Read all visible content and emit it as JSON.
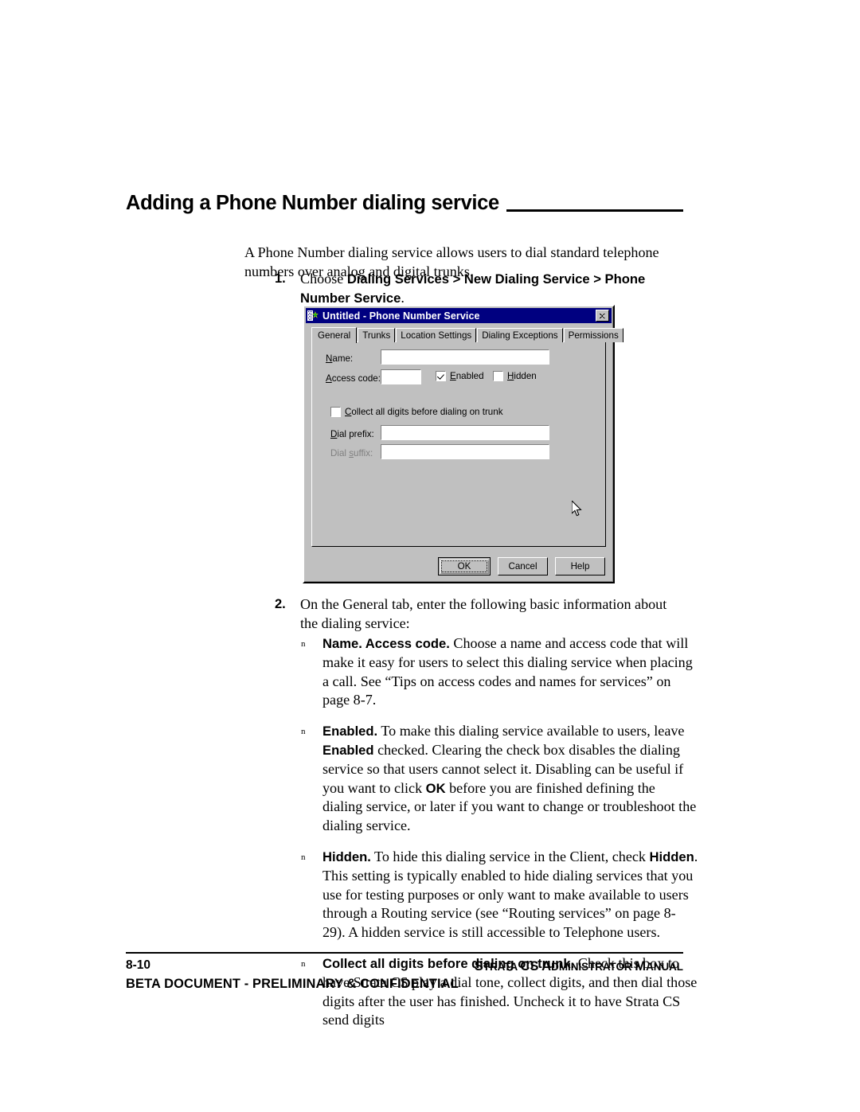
{
  "page": {
    "heading": "Adding a Phone Number dialing service",
    "intro": "A Phone Number dialing service allows users to dial standard telephone numbers over analog and digital trunks."
  },
  "steps": [
    {
      "number": "1.",
      "text_lead": "Choose ",
      "text_bold": "Dialing Services > New Dialing Service > Phone Number Service",
      "text_tail": "."
    },
    {
      "number": "2.",
      "text": "On the General tab, enter the following basic information about the dialing service:"
    }
  ],
  "bullets": [
    {
      "mark": "n",
      "term": "Name. Access code.",
      "body": " Choose a name and access code that will make it easy for users to select this dialing service when placing a call. See “Tips on access codes and names for services” on page 8-7."
    },
    {
      "mark": "n",
      "term": "Enabled.",
      "body_1": " To make this dialing service available to users, leave ",
      "term_2": "Enabled",
      "body_2": " checked. Clearing the check box disables the dialing service so that users cannot select it. Disabling can be useful if you want to click ",
      "term_3": "OK",
      "body_3": " before you are finished defining the dialing service, or later if you want to change or troubleshoot the dialing service."
    },
    {
      "mark": "n",
      "term": "Hidden.",
      "body_1": " To hide this dialing service in the Client, check ",
      "term_2": "Hidden",
      "body_2": ". This setting is typically enabled to hide dialing services that you use for testing purposes or only want to make available to users through a Routing service (see “Routing services” on page 8-29). A hidden service is still accessible to Telephone users."
    },
    {
      "mark": "n",
      "term": "Collect all digits before dialing on trunk.",
      "body": " Check this box to have Strata CS play a dial tone, collect digits, and then dial those digits after the user has finished. Uncheck it to have Strata CS send digits"
    }
  ],
  "dialog": {
    "title": "Untitled - Phone Number Service",
    "icon": "phone-service-icon",
    "close_icon": "close-icon",
    "tabs": [
      {
        "label": "General",
        "active": true
      },
      {
        "label": "Trunks",
        "active": false
      },
      {
        "label": "Location Settings",
        "active": false
      },
      {
        "label": "Dialing Exceptions",
        "active": false
      },
      {
        "label": "Permissions",
        "active": false
      }
    ],
    "fields": {
      "name_label_accel": "N",
      "name_label_rest": "ame:",
      "name_value": "",
      "access_code_label_accel": "A",
      "access_code_label_rest": "ccess code:",
      "access_code_value": "",
      "dial_prefix_label_accel": "D",
      "dial_prefix_label_rest": "ial prefix:",
      "dial_prefix_value": "",
      "dial_suffix_label_pre": "Dial ",
      "dial_suffix_label_accel": "s",
      "dial_suffix_label_rest": "uffix:",
      "dial_suffix_value": "",
      "dial_suffix_disabled": true
    },
    "checkboxes": [
      {
        "label_accel": "E",
        "label_rest": "nabled",
        "checked": true
      },
      {
        "label_accel": "H",
        "label_rest": "idden",
        "checked": false
      },
      {
        "label_pre": "C",
        "label_rest": "ollect all digits before dialin",
        "label_accel2": "g",
        "label_rest2": " on trunk",
        "checked": false
      }
    ],
    "buttons": [
      {
        "label": "OK",
        "default": true
      },
      {
        "label": "Cancel",
        "default": false
      },
      {
        "label": "Help",
        "default": false
      }
    ]
  },
  "footer": {
    "page_number": "8-10",
    "manual_parts": [
      {
        "cap": "S",
        "rest": "TRATA"
      },
      {
        "cap": "CS",
        "rest": ""
      },
      {
        "cap": "A",
        "rest": "DMINISTRATOR"
      },
      {
        "cap": "M",
        "rest": "ANUAL"
      }
    ],
    "manual_plain": "STRATA CS ADMINISTRATOR MANUAL",
    "beta": "BETA DOCUMENT - PRELIMINARY & CONFIDENTIAL"
  }
}
